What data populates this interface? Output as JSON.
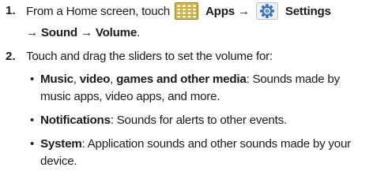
{
  "steps": [
    {
      "number": "1.",
      "line1": {
        "pre": "From a Home screen, touch",
        "apps": "Apps",
        "arrow1": "→",
        "settings": "Settings"
      },
      "line2": {
        "arrow2": "→",
        "sound": "Sound",
        "arrow3": "→",
        "volume": "Volume",
        "period": "."
      }
    },
    {
      "number": "2.",
      "intro": "Touch and drag the sliders to set the volume for:",
      "bullets": [
        {
          "b1": "Music",
          "sep1": ", ",
          "b2": "video",
          "sep2": ", ",
          "b3": "games and other media",
          "rest": ": Sounds made by",
          "cont": "music apps, video apps, and more."
        },
        {
          "term": "Notifications",
          "rest": ": Sounds for alerts to other events."
        },
        {
          "term": "System",
          "rest": ": Application sounds and other sounds made by your",
          "cont": "device."
        }
      ]
    }
  ],
  "icons": {
    "apps": "apps-grid-icon",
    "settings": "settings-gear-icon"
  },
  "colors": {
    "text": "#1c1c1c",
    "apps_icon_fill": "#e0c036",
    "apps_icon_border": "#9a7d1c",
    "gear_icon_blue": "#3d6fb8"
  }
}
